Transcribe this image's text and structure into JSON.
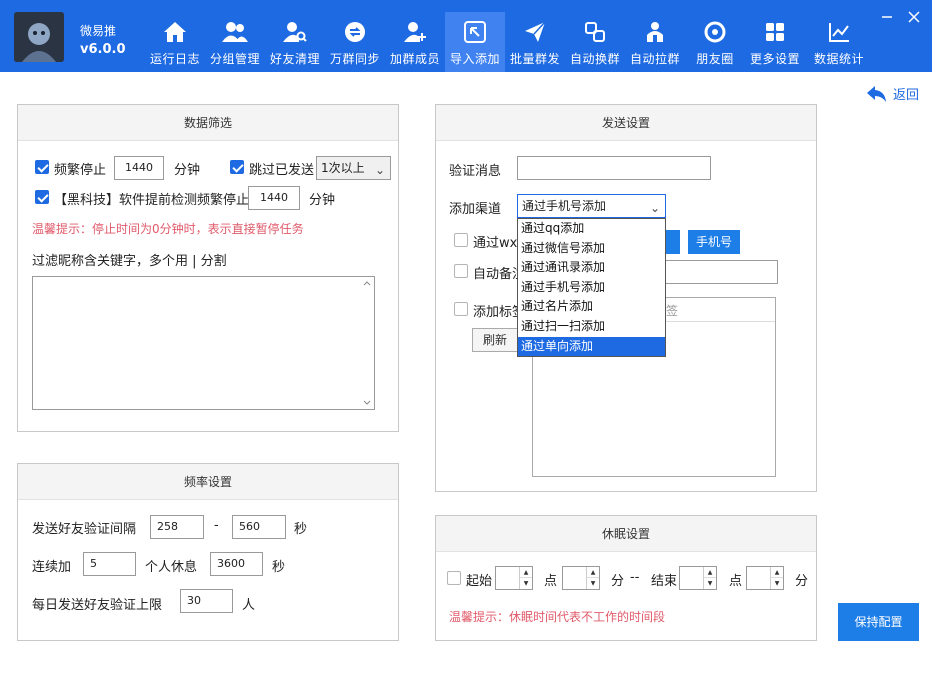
{
  "app": {
    "name": "微易推",
    "version": "v6.0.0"
  },
  "nav": [
    {
      "label": "运行日志",
      "icon": "home-icon"
    },
    {
      "label": "分组管理",
      "icon": "users-icon"
    },
    {
      "label": "好友清理",
      "icon": "user-search-icon"
    },
    {
      "label": "万群同步",
      "icon": "sync-icon"
    },
    {
      "label": "加群成员",
      "icon": "user-add-icon"
    },
    {
      "label": "导入添加",
      "icon": "import-icon"
    },
    {
      "label": "批量群发",
      "icon": "send-icon"
    },
    {
      "label": "自动换群",
      "icon": "switch-icon"
    },
    {
      "label": "自动拉群",
      "icon": "group-pull-icon"
    },
    {
      "label": "朋友圈",
      "icon": "aperture-icon"
    },
    {
      "label": "更多设置",
      "icon": "grid-icon"
    },
    {
      "label": "数据统计",
      "icon": "chart-icon"
    }
  ],
  "active_nav": "导入添加",
  "back_label": "返回",
  "data_filter": {
    "title": "数据筛选",
    "freq_stop_label": "频繁停止",
    "freq_stop_value": "1440",
    "minute_label": "分钟",
    "skip_sent_label": "跳过已发送",
    "skip_sent_select": "1次以上",
    "blacktech_label": "【黑科技】软件提前检测频繁停止",
    "blacktech_value": "1440",
    "minute_label2": "分钟",
    "hint": "温馨提示：停止时间为0分钟时，表示直接暂停任务",
    "keyword_label": "过滤昵称含关键字，多个用 | 分割"
  },
  "frequency": {
    "title": "频率设置",
    "interval_label": "发送好友验证间隔",
    "interval_min": "258",
    "dash": "-",
    "interval_max": "560",
    "second_label": "秒",
    "continuous_label": "连续加",
    "continuous_value": "5",
    "rest_label": "个人休息",
    "rest_value": "3600",
    "second_label2": "秒",
    "daily_label": "每日发送好友验证上限",
    "daily_value": "30",
    "person_label": "人"
  },
  "send_settings": {
    "title": "发送设置",
    "verify_label": "验证消息",
    "verify_value": "",
    "channel_label": "添加渠道",
    "channel_selected": "通过手机号添加",
    "via_wx_label": "通过wxi",
    "phone_button": "手机号",
    "auto_remark_label": "自动备注",
    "add_tag_label": "添加标签",
    "tag_column_text": "签",
    "refresh_button": "刷新",
    "channel_options": [
      "通过qq添加",
      "通过微信号添加",
      "通过通讯录添加",
      "通过手机号添加",
      "通过名片添加",
      "通过扫一扫添加",
      "通过单向添加"
    ],
    "highlighted_option": "通过单向添加"
  },
  "sleep": {
    "title": "休眠设置",
    "start_label": "起始",
    "hour_label": "点",
    "minute_label": "分",
    "sep": "--",
    "end_label": "结束",
    "hour_label2": "点",
    "minute_label2": "分",
    "hint": "温馨提示：休眠时间代表不工作的时间段"
  },
  "save_button": "保持配置",
  "colors": {
    "primary": "#1e6ae2",
    "hint": "#e05a6a"
  }
}
